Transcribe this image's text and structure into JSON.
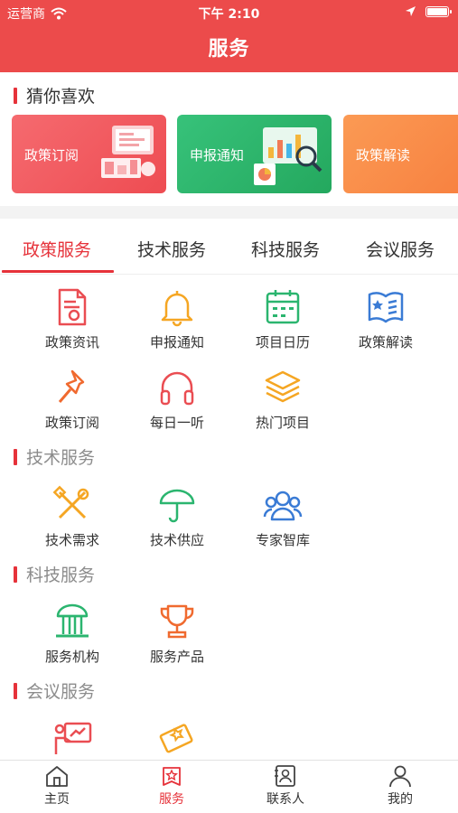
{
  "status_bar": {
    "carrier": "运营商",
    "time": "下午 2:10"
  },
  "header": {
    "title": "服务"
  },
  "guess": {
    "title": "猜你喜欢",
    "cards": [
      {
        "label": "政策订阅",
        "color": "#f0575d"
      },
      {
        "label": "申报通知",
        "color": "#2fb56b"
      },
      {
        "label": "政策解读",
        "color": "#f98a4a"
      }
    ]
  },
  "tabs": [
    {
      "label": "政策服务",
      "active": true
    },
    {
      "label": "技术服务",
      "active": false
    },
    {
      "label": "科技服务",
      "active": false
    },
    {
      "label": "会议服务",
      "active": false
    }
  ],
  "policy_items": [
    {
      "label": "政策资讯",
      "icon": "document-seal-icon"
    },
    {
      "label": "申报通知",
      "icon": "bell-icon"
    },
    {
      "label": "项目日历",
      "icon": "calendar-icon"
    },
    {
      "label": "政策解读",
      "icon": "open-book-star-icon"
    },
    {
      "label": "政策订阅",
      "icon": "pushpin-icon"
    },
    {
      "label": "每日一听",
      "icon": "headphones-icon"
    },
    {
      "label": "热门项目",
      "icon": "layers-icon"
    }
  ],
  "tech_section": {
    "title": "技术服务",
    "items": [
      {
        "label": "技术需求",
        "icon": "tools-icon"
      },
      {
        "label": "技术供应",
        "icon": "umbrella-icon"
      },
      {
        "label": "专家智库",
        "icon": "people-icon"
      }
    ]
  },
  "sci_section": {
    "title": "科技服务",
    "items": [
      {
        "label": "服务机构",
        "icon": "institution-building-icon"
      },
      {
        "label": "服务产品",
        "icon": "trophy-icon"
      }
    ]
  },
  "meeting_section": {
    "title": "会议服务",
    "items": [
      {
        "icon": "presentation-icon"
      },
      {
        "icon": "ticket-icon"
      }
    ]
  },
  "tabbar": [
    {
      "label": "主页",
      "icon": "home-icon",
      "active": false
    },
    {
      "label": "服务",
      "icon": "service-star-icon",
      "active": true
    },
    {
      "label": "联系人",
      "icon": "contacts-icon",
      "active": false
    },
    {
      "label": "我的",
      "icon": "user-icon",
      "active": false
    }
  ],
  "colors": {
    "brand": "#ec4b4b",
    "accent": "#e6323a"
  }
}
